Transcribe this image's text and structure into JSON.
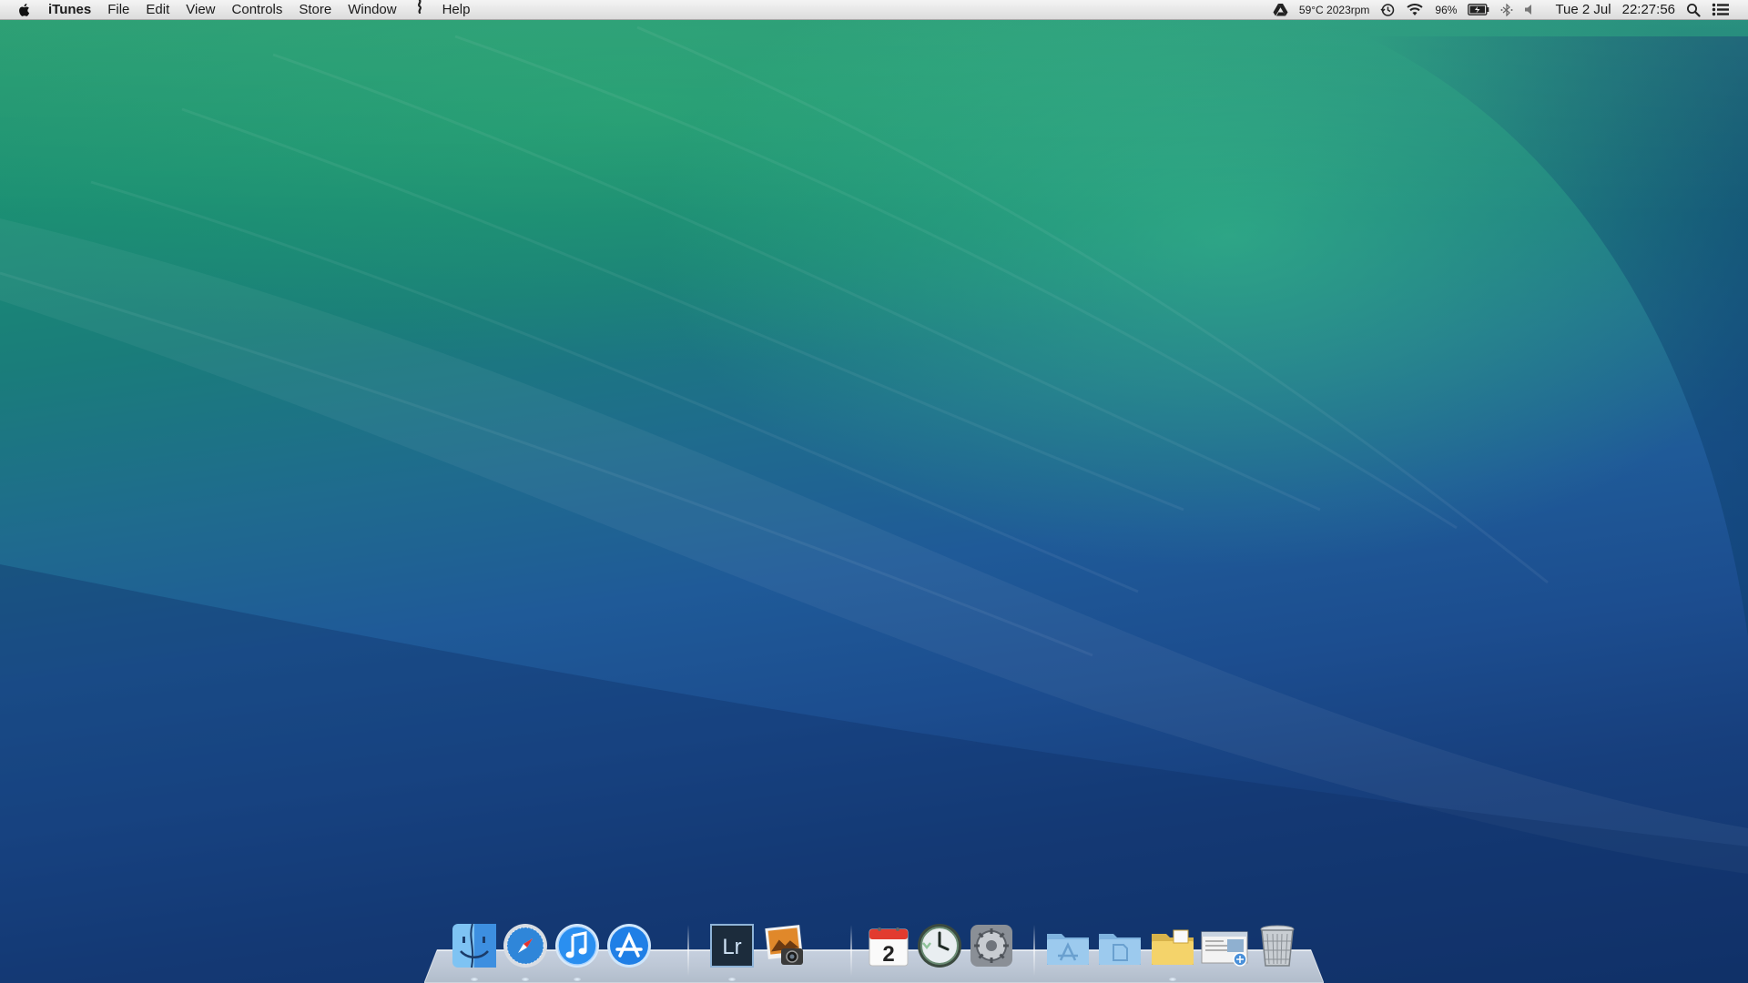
{
  "menubar": {
    "apple_icon": "apple-logo-icon",
    "app_name": "iTunes",
    "menus": [
      "File",
      "Edit",
      "View",
      "Controls",
      "Store",
      "Window",
      "Help"
    ],
    "script_icon": "script-menu-icon",
    "status": {
      "drive_icon": "google-drive-icon",
      "temperature": "59°C 2023rpm",
      "time_machine_icon": "time-machine-icon",
      "wifi_icon": "wifi-icon",
      "battery_percent": "96%",
      "battery_icon": "battery-icon",
      "bluetooth_icon": "bluetooth-icon",
      "volume_icon": "volume-icon",
      "date": "Tue 2 Jul",
      "time": "22:27:56",
      "spotlight_icon": "spotlight-search-icon",
      "notification_icon": "notification-center-icon"
    }
  },
  "dock": {
    "apps": [
      {
        "name": "Finder",
        "icon": "finder-icon"
      },
      {
        "name": "Safari",
        "icon": "safari-icon"
      },
      {
        "name": "iTunes",
        "icon": "itunes-icon"
      },
      {
        "name": "App Store",
        "icon": "app-store-icon"
      },
      {
        "name": "Lightroom",
        "icon": "lightroom-icon",
        "label": "Lr"
      },
      {
        "name": "iPhoto",
        "icon": "iphoto-icon"
      },
      {
        "name": "Calendar",
        "icon": "calendar-icon",
        "day": "2"
      },
      {
        "name": "Time Machine",
        "icon": "time-machine-app-icon"
      },
      {
        "name": "System Preferences",
        "icon": "system-preferences-icon"
      }
    ],
    "stacks": [
      {
        "name": "Applications",
        "icon": "applications-folder-icon"
      },
      {
        "name": "Documents",
        "icon": "documents-folder-icon"
      },
      {
        "name": "Downloads",
        "icon": "downloads-folder-icon"
      },
      {
        "name": "Document Stack",
        "icon": "document-stack-icon"
      },
      {
        "name": "Trash",
        "icon": "trash-icon"
      }
    ],
    "colors": {
      "shelf": "#cfd6df",
      "accent": "#2a7ff0"
    }
  }
}
